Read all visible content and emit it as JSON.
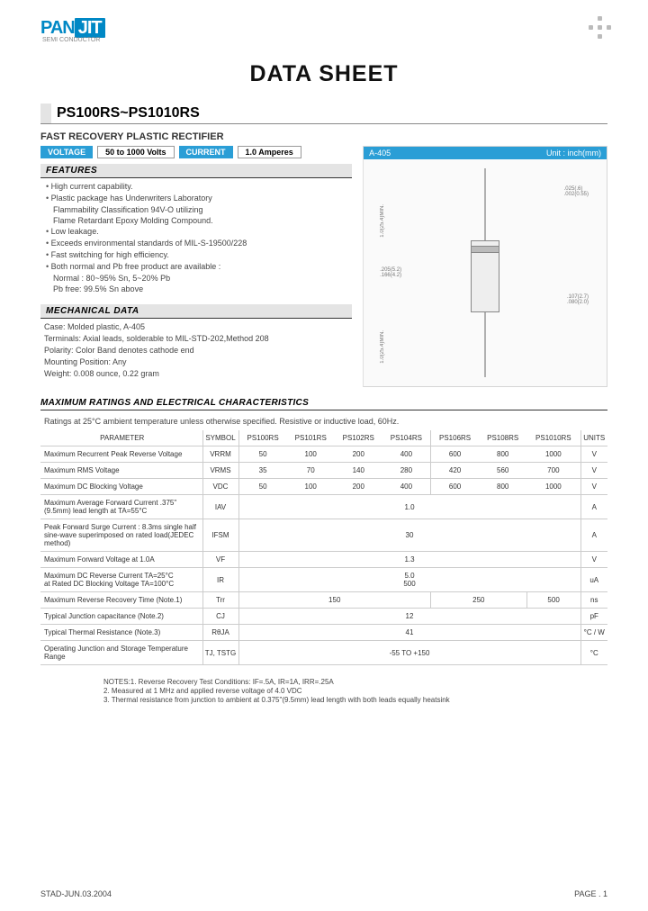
{
  "brand": {
    "pan": "PAN",
    "jit": "JIT",
    "sub": "SEMI\nCONDUCTOR"
  },
  "doc_title": "DATA  SHEET",
  "part_number": "PS100RS~PS1010RS",
  "subtitle": "FAST RECOVERY PLASTIC RECTIFIER",
  "spec_tags": {
    "voltage_label": "VOLTAGE",
    "voltage_value": "50 to 1000 Volts",
    "current_label": "CURRENT",
    "current_value": "1.0 Amperes"
  },
  "diagram": {
    "title": "A-405",
    "unit": "Unit : inch(mm)",
    "d1": ".025(.6)\n.002(0.55)",
    "d2": "1.0(25.4)MIN.",
    "d3": ".205(5.2)\n.166(4.2)",
    "d4": ".107(2.7)\n.080(2.0)",
    "d5": "1.0(25.4)MIN."
  },
  "sections": {
    "features": "FEATURES",
    "mechanical": "MECHANICAL DATA",
    "maxratings": "MAXIMUM RATINGS AND ELECTRICAL CHARACTERISTICS"
  },
  "features": [
    "High current capability.",
    "Plastic package has Underwriters Laboratory",
    "Low leakage.",
    "Exceeds environmental standards of MIL-S-19500/228",
    "Fast switching for high efficiency.",
    "Both normal and Pb free product are available :"
  ],
  "features_sub1a": "Flammability Classification 94V-O utilizing",
  "features_sub1b": "Flame Retardant Epoxy Molding Compound.",
  "features_sub2a": "Normal : 80~95% Sn, 5~20% Pb",
  "features_sub2b": "Pb free: 99.5% Sn above",
  "mechanical": {
    "case": "Case: Molded plastic, A-405",
    "terminals": "Terminals: Axial leads, solderable to MIL-STD-202,Method 208",
    "polarity": "Polarity: Color Band denotes cathode end",
    "mounting": "Mounting Position: Any",
    "weight": "Weight: 0.008 ounce, 0.22 gram"
  },
  "ratings_note": "Ratings at 25°C ambient temperature unless otherwise specified.  Resistive or inductive load, 60Hz.",
  "table_headers": {
    "parameter": "PARAMETER",
    "symbol": "SYMBOL",
    "parts": [
      "PS100RS",
      "PS101RS",
      "PS102RS",
      "PS104RS",
      "PS106RS",
      "PS108RS",
      "PS1010RS"
    ],
    "units": "UNITS"
  },
  "rows": [
    {
      "param": "Maximum Recurrent Peak Reverse Voltage",
      "sym": "VRRM",
      "vals": [
        "50",
        "100",
        "200",
        "400",
        "600",
        "800",
        "1000"
      ],
      "unit": "V"
    },
    {
      "param": "Maximum RMS Voltage",
      "sym": "VRMS",
      "vals": [
        "35",
        "70",
        "140",
        "280",
        "420",
        "560",
        "700"
      ],
      "unit": "V"
    },
    {
      "param": "Maximum DC Blocking Voltage",
      "sym": "VDC",
      "vals": [
        "50",
        "100",
        "200",
        "400",
        "600",
        "800",
        "1000"
      ],
      "unit": "V"
    },
    {
      "param": "Maximum Average Forward  Current .375\"(9.5mm) lead length at TA=55°C",
      "sym": "IAV",
      "span": "1.0",
      "unit": "A"
    },
    {
      "param": "Peak Forward Surge Current : 8.3ms single half sine-wave superimposed on rated load(JEDEC method)",
      "sym": "IFSM",
      "span": "30",
      "unit": "A"
    },
    {
      "param": "Maximum Forward Voltage at 1.0A",
      "sym": "VF",
      "span": "1.3",
      "unit": "V"
    },
    {
      "param": "Maximum DC Reverse Current TA=25°C\nat Rated DC Blocking Voltage  TA=100°C",
      "sym": "IR",
      "span": "5.0\n500",
      "unit": "uA"
    },
    {
      "param": "Maximum Reverse Recovery Time (Note.1)",
      "sym": "Trr",
      "group": [
        "150",
        "250",
        "500"
      ],
      "groupSplit": [
        4,
        2,
        1
      ],
      "unit": "ns"
    },
    {
      "param": "Typical Junction capacitance (Note.2)",
      "sym": "CJ",
      "span": "12",
      "unit": "pF"
    },
    {
      "param": "Typical Thermal Resistance (Note.3)",
      "sym": "RθJA",
      "span": "41",
      "unit": "°C / W"
    },
    {
      "param": "Operating Junction and Storage Temperature Range",
      "sym": "TJ, TSTG",
      "span": "-55 TO +150",
      "unit": "°C"
    }
  ],
  "notes": {
    "l1": "NOTES:1. Reverse Recovery Test Conditions: IF=.5A, IR=1A, IRR=.25A",
    "l2": "2. Measured at 1 MHz and applied reverse voltage of 4.0 VDC",
    "l3": "3. Thermal resistance from junction to ambient  at 0.375\"(9.5mm) lead length with both leads equally heatsink"
  },
  "footer": {
    "left": "STAD-JUN.03.2004",
    "right": "PAGE .  1"
  }
}
